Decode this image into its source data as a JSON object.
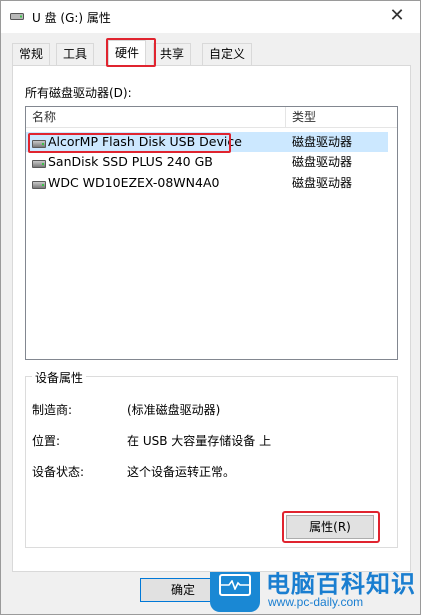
{
  "window": {
    "title": "U 盘 (G:) 属性",
    "close_glyph": "✕"
  },
  "tabs": [
    {
      "label": "常规"
    },
    {
      "label": "工具"
    },
    {
      "label": "硬件"
    },
    {
      "label": "共享"
    },
    {
      "label": "自定义"
    }
  ],
  "active_tab": "硬件",
  "drives_label": "所有磁盘驱动器(D):",
  "columns": {
    "name": "名称",
    "type": "类型"
  },
  "drives": [
    {
      "name": "AlcorMP Flash Disk USB Device",
      "type": "磁盘驱动器",
      "selected": true
    },
    {
      "name": "SanDisk SSD PLUS 240 GB",
      "type": "磁盘驱动器"
    },
    {
      "name": "WDC WD10EZEX-08WN4A0",
      "type": "磁盘驱动器"
    }
  ],
  "device_properties": {
    "title": "设备属性",
    "manufacturer_label": "制造商:",
    "manufacturer_value": "(标准磁盘驱动器)",
    "location_label": "位置:",
    "location_value": "在 USB 大容量存储设备 上",
    "status_label": "设备状态:",
    "status_value": "这个设备运转正常。",
    "properties_button": "属性(R)"
  },
  "ok_button": "确定",
  "watermark": {
    "title": "电脑百科知识",
    "url": "www.pc-daily.com"
  },
  "colors": {
    "highlight": "#e0242f",
    "selection": "#cce8ff",
    "brand": "#1a88d4"
  }
}
